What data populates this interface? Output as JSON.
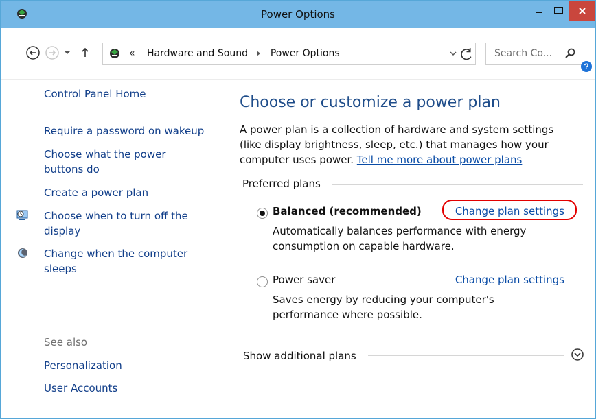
{
  "window": {
    "title": "Power Options",
    "controls": [
      "minimize",
      "maximize",
      "close"
    ]
  },
  "navigation": {
    "breadcrumb": [
      "«",
      "Hardware and Sound",
      "Power Options"
    ],
    "search_placeholder": "Search Co..."
  },
  "sidebar": {
    "links": [
      "Control Panel Home",
      "Require a password on wakeup",
      "Choose what the power buttons do",
      "Create a power plan",
      "Choose when to turn off the display",
      "Change when the computer sleeps"
    ],
    "see_also_label": "See also",
    "see_also_links": [
      "Personalization",
      "User Accounts"
    ]
  },
  "main": {
    "heading": "Choose or customize a power plan",
    "description": "A power plan is a collection of hardware and system settings (like display brightness, sleep, etc.) that manages how your computer uses power.",
    "description_link": "Tell me more about power plans",
    "preferred_label": "Preferred plans",
    "plans": [
      {
        "label": "Balanced (recommended)",
        "link": "Change plan settings",
        "description": "Automatically balances performance with energy consumption on capable hardware.",
        "selected": true
      },
      {
        "label": "Power saver",
        "link": "Change plan settings",
        "description": "Saves energy by reducing your computer's performance where possible.",
        "selected": false
      }
    ],
    "show_additional": "Show additional plans"
  },
  "colors": {
    "title_bar": "#74b7e6",
    "close_button": "#c9463d",
    "link": "#0a4ca6",
    "heading": "#1f4d8a",
    "highlight": "#e30000"
  },
  "icons": {
    "app": "power-options-icon",
    "back": "back-arrow-icon",
    "forward": "forward-arrow-icon",
    "up": "up-arrow-icon",
    "refresh": "refresh-icon",
    "search": "search-icon",
    "help": "help-icon",
    "display": "display-clock-icon",
    "sleep": "moon-icon",
    "expand": "expand-circle-icon"
  }
}
